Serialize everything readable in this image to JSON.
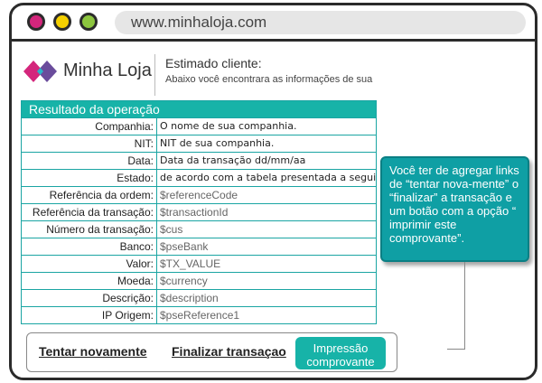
{
  "browser": {
    "url": "www.minhaloja.com",
    "dots": {
      "red": "#d4267c",
      "yellow": "#f5d000",
      "green": "#8dc63f"
    }
  },
  "header": {
    "logo_text": "Minha Loja",
    "greeting": "Estimado cliente:",
    "subtitle": "Abaixo você encontrara as informações de sua"
  },
  "result": {
    "title": "Resultado da operação",
    "rows": [
      {
        "label": "Companhia:",
        "value": "O nome de sua companhia."
      },
      {
        "label": "NIT:",
        "value": "NIT de sua companhia."
      },
      {
        "label": "Data:",
        "value": "Data da transação dd/mm/aa"
      },
      {
        "label": "Estado:",
        "value": "de acordo com a tabela presentada a seguir."
      },
      {
        "label": "Referência da ordem:",
        "value": "$referenceCode"
      },
      {
        "label": "Referência da transação:",
        "value": "$transactionId"
      },
      {
        "label": "Número da transação:",
        "value": "$cus"
      },
      {
        "label": "Banco:",
        "value": "$pseBank"
      },
      {
        "label": "Valor:",
        "value": "$TX_VALUE"
      },
      {
        "label": "Moeda:",
        "value": "$currency"
      },
      {
        "label": "Descrição:",
        "value": "$description"
      },
      {
        "label": "IP Origem:",
        "value": "$pseReference1"
      }
    ]
  },
  "tooltip": {
    "text": "Você ter de agregar links de “tentar nova-mente” o “finalizar” a transação  e um botão com a opção “ imprimir este comprovante”."
  },
  "actions": {
    "retry": "Tentar novamente",
    "finish": "Finalizar transaçao",
    "print_line1": "Impressão",
    "print_line2": "comprovante"
  },
  "colors": {
    "accent": "#17b3a8",
    "tooltip": "#0f9fa4",
    "logo_pink": "#d4267c"
  }
}
